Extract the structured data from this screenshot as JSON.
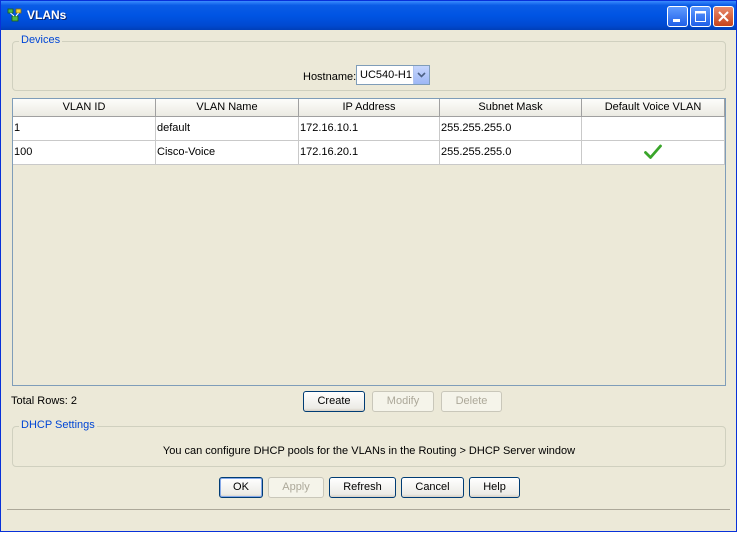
{
  "window": {
    "title": "VLANs"
  },
  "devices": {
    "group_label": "Devices",
    "hostname_label": "Hostname:",
    "hostname_value": "UC540-H1"
  },
  "table": {
    "columns": [
      "VLAN ID",
      "VLAN Name",
      "IP Address",
      "Subnet Mask",
      "Default Voice VLAN"
    ],
    "rows": [
      {
        "vlan_id": "1",
        "vlan_name": "default",
        "ip_address": "172.16.10.1",
        "subnet_mask": "255.255.255.0",
        "default_voice": false
      },
      {
        "vlan_id": "100",
        "vlan_name": "Cisco-Voice",
        "ip_address": "172.16.20.1",
        "subnet_mask": "255.255.255.0",
        "default_voice": true
      }
    ]
  },
  "total_rows": "Total Rows: 2",
  "table_buttons": {
    "create": "Create",
    "modify": "Modify",
    "delete": "Delete"
  },
  "dhcp": {
    "group_label": "DHCP Settings",
    "message": "You can configure DHCP pools for the VLANs in the Routing > DHCP Server window"
  },
  "dialog_buttons": {
    "ok": "OK",
    "apply": "Apply",
    "refresh": "Refresh",
    "cancel": "Cancel",
    "help": "Help"
  },
  "icons": {
    "title": "network-vlan-icon",
    "check": "checkmark-icon",
    "check_color": "#3aa52a"
  }
}
